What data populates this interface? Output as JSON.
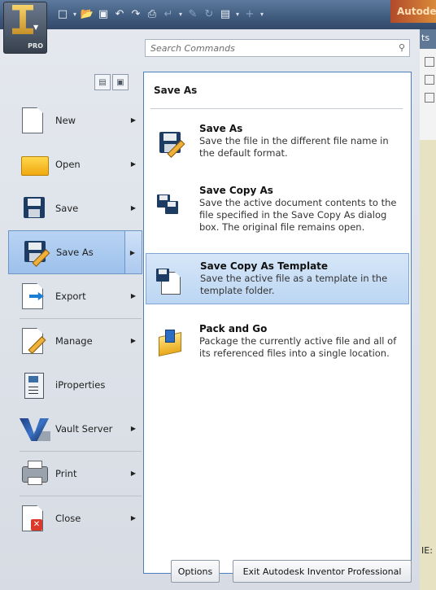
{
  "app": {
    "edition_badge": "PRO",
    "brand_text": "Autodesk"
  },
  "background": {
    "tab_fragment": "ts",
    "lower_fragment": "IE:"
  },
  "search": {
    "placeholder": "Search Commands"
  },
  "menu": {
    "items": [
      {
        "label": "New",
        "icon": "new-document-icon"
      },
      {
        "label": "Open",
        "icon": "folder-icon"
      },
      {
        "label": "Save",
        "icon": "floppy-disk-icon"
      },
      {
        "label": "Save As",
        "icon": "save-as-icon",
        "active": true
      },
      {
        "label": "Export",
        "icon": "export-icon"
      },
      {
        "label": "Manage",
        "icon": "manage-icon"
      },
      {
        "label": "iProperties",
        "icon": "iproperties-icon"
      },
      {
        "label": "Vault Server",
        "icon": "vault-icon"
      },
      {
        "label": "Print",
        "icon": "printer-icon"
      },
      {
        "label": "Close",
        "icon": "close-document-icon"
      }
    ]
  },
  "submenu": {
    "title": "Save As",
    "items": [
      {
        "title": "Save As",
        "desc": "Save the file in the different file name in the default format."
      },
      {
        "title": "Save Copy As",
        "desc": "Save the active document contents to the file specified in the Save Copy As dialog box. The original file remains open."
      },
      {
        "title": "Save Copy As Template",
        "desc": "Save the active file as a template in the template folder.",
        "highlighted": true
      },
      {
        "title": "Pack and Go",
        "desc": "Package the currently active file and all of its referenced files into a single location."
      }
    ]
  },
  "buttons": {
    "options": "Options",
    "exit": "Exit Autodesk Inventor Professional"
  },
  "colors": {
    "highlight": "#bcd6f3",
    "panel_border": "#4d7fbe",
    "titlebar": "#3f5a7c"
  }
}
